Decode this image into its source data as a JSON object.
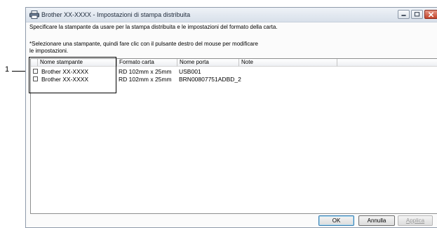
{
  "callout": {
    "number": "1"
  },
  "window": {
    "title": "Brother XX-XXXX - Impostazioni di stampa distribuita",
    "icons": {
      "app": "printer-icon",
      "minimize": "minimize-icon",
      "maximize": "maximize-icon",
      "close": "close-icon"
    },
    "colors": {
      "close_button": "#c2432a",
      "titlebar": "#dbe3ec"
    }
  },
  "instructions": {
    "line1": "Specificare la stampante da usare per la stampa distribuita e le impostazioni del formato della carta.",
    "line2": "*Selezionare una stampante, quindi fare clic con il pulsante destro del mouse per modificare le impostazioni."
  },
  "table": {
    "columns": [
      "Nome stampante",
      "Formato carta",
      "Nome porta",
      "Note"
    ],
    "rows": [
      {
        "checked": false,
        "printer": "Brother XX-XXXX",
        "paper": "RD 102mm x 25mm",
        "port": "USB001",
        "note": ""
      },
      {
        "checked": false,
        "printer": "Brother XX-XXXX",
        "paper": "RD 102mm x 25mm",
        "port": "BRN00807751ADBD_2",
        "note": ""
      }
    ]
  },
  "buttons": {
    "ok": "OK",
    "cancel": "Annulla",
    "apply": "Applica"
  }
}
